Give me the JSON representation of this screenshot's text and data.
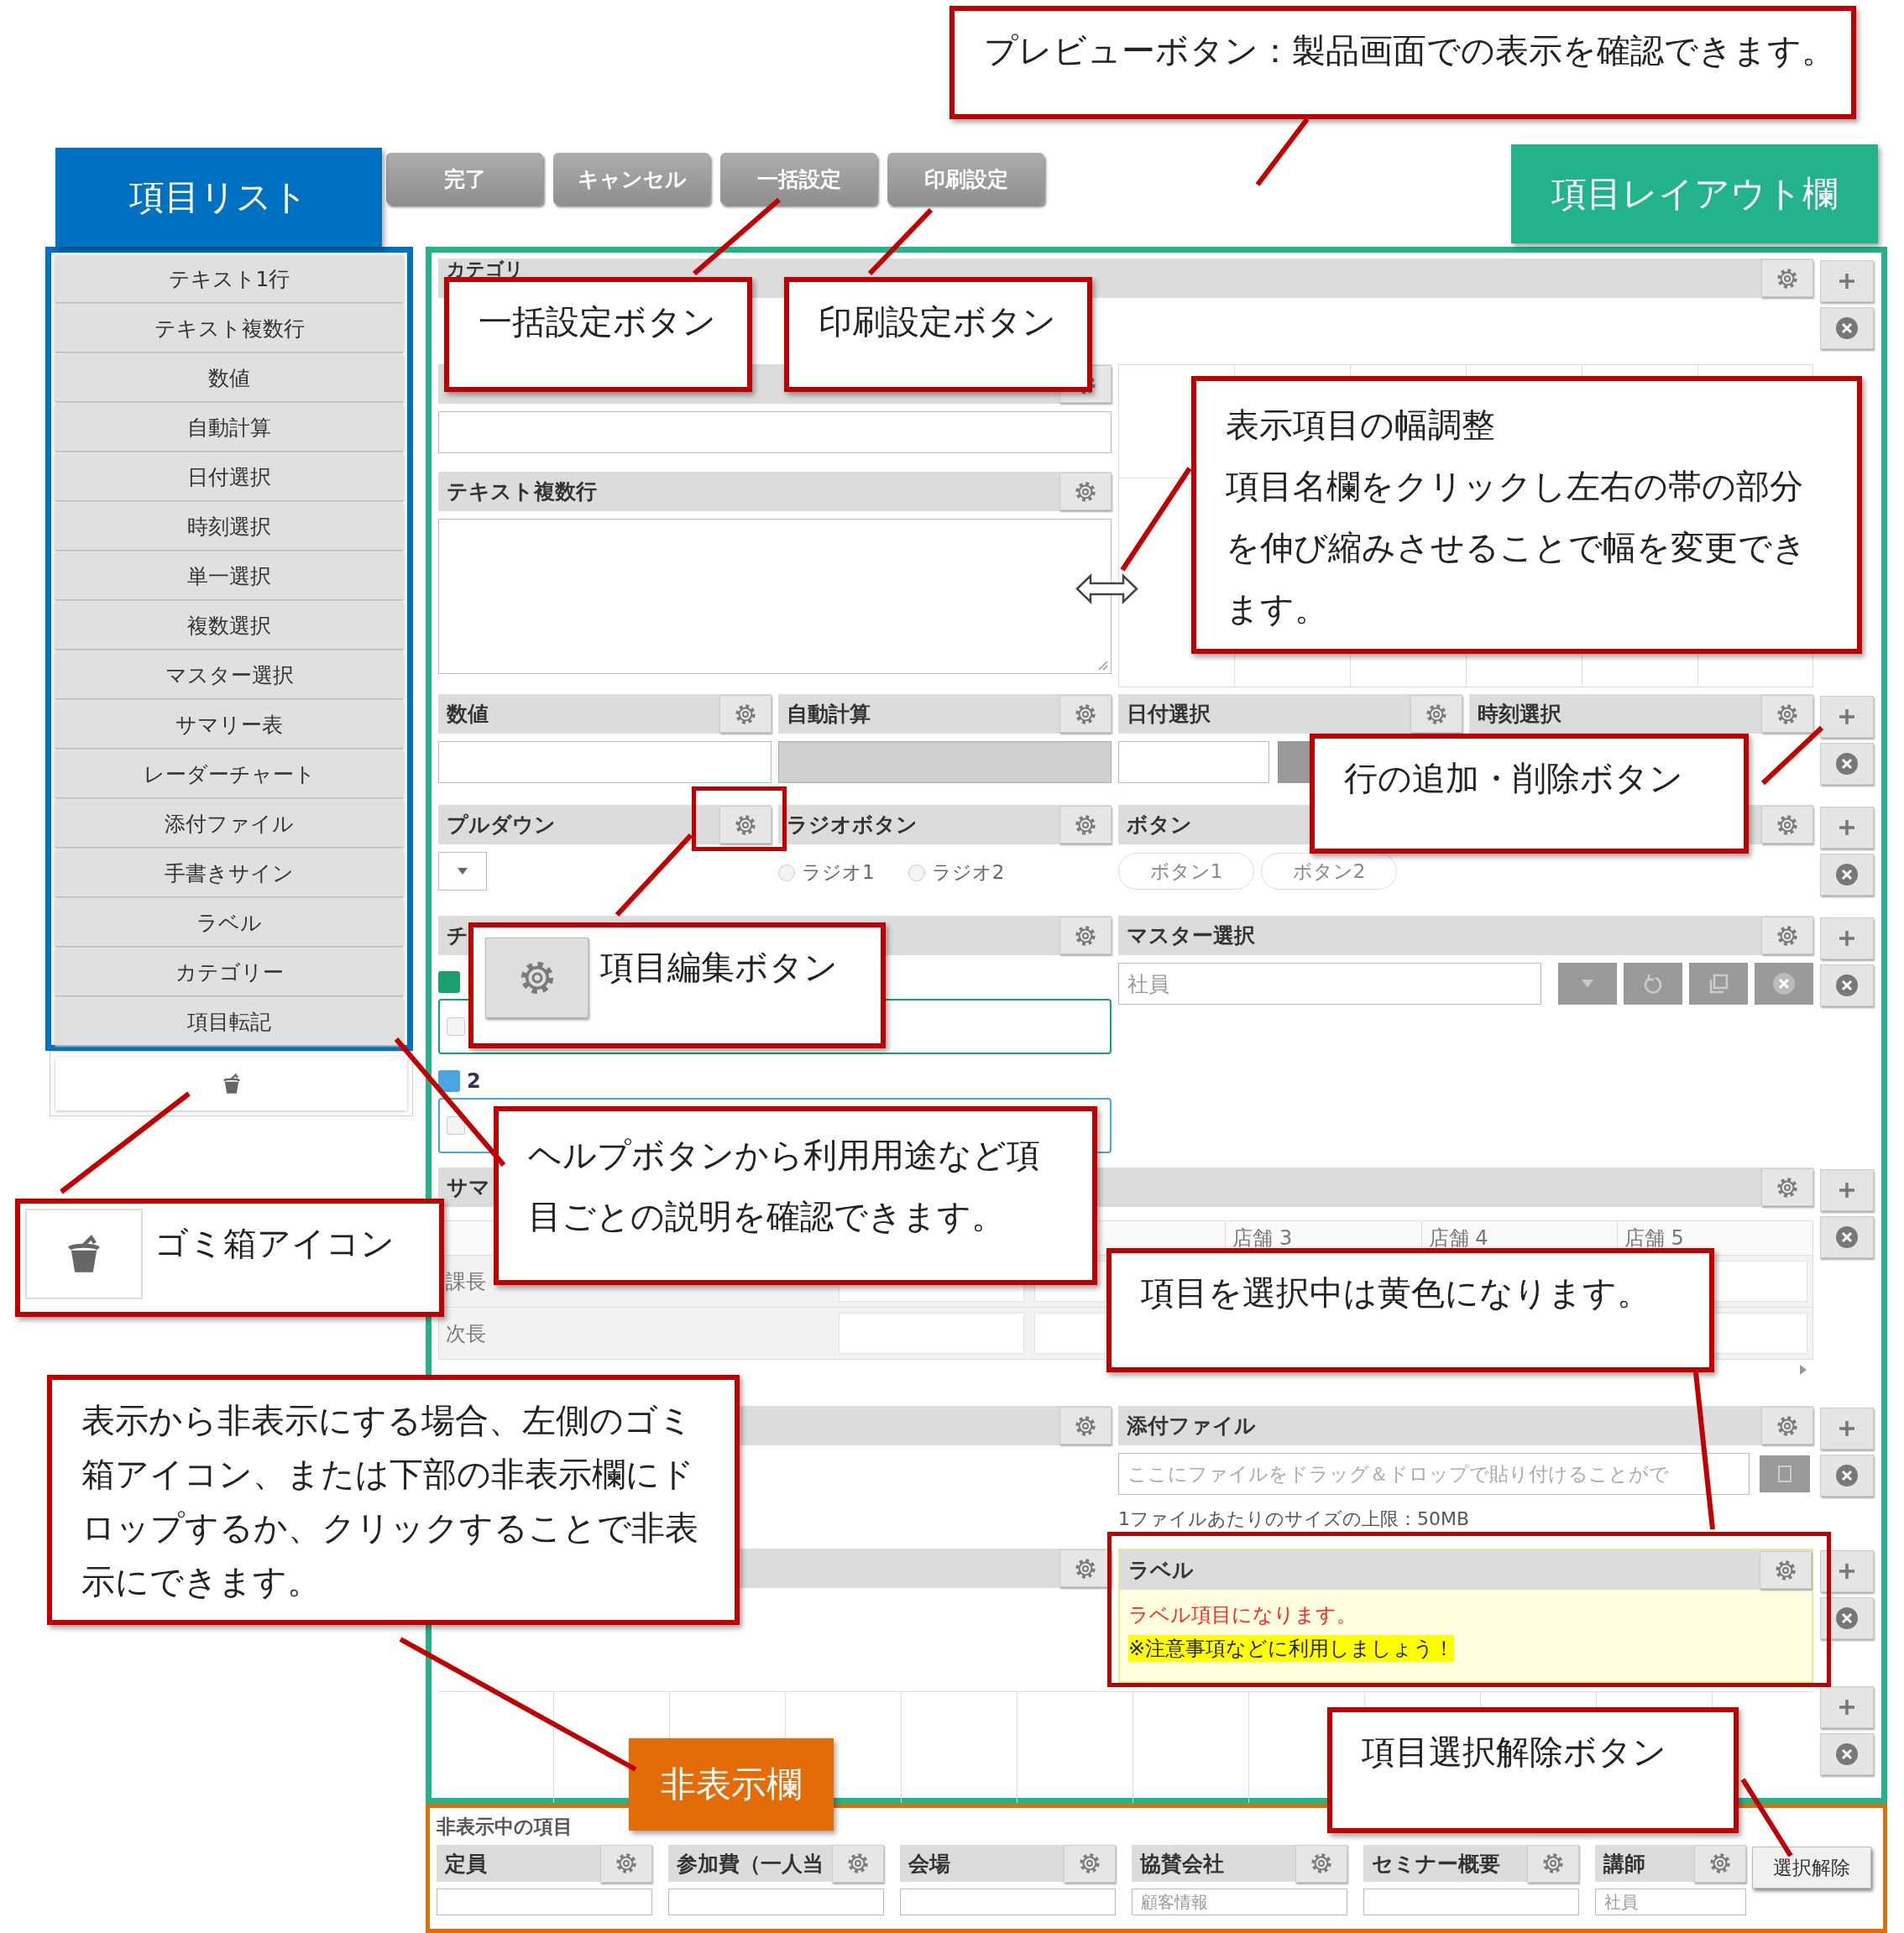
{
  "toolbar": {
    "buttons": [
      "完了",
      "キャンセル",
      "一括設定",
      "印刷設定"
    ]
  },
  "item_list": {
    "items": [
      "テキスト1行",
      "テキスト複数行",
      "数値",
      "自動計算",
      "日付選択",
      "時刻選択",
      "単一選択",
      "複数選択",
      "マスター選択",
      "サマリー表",
      "レーダーチャート",
      "添付ファイル",
      "手書きサイン",
      "ラベル",
      "カテゴリー",
      "項目転記"
    ]
  },
  "layout": {
    "category": {
      "label": "カテゴリ"
    },
    "multiline": {
      "label": "テキスト複数行"
    },
    "number": {
      "label": "数値"
    },
    "auto_calc": {
      "label": "自動計算",
      "disabled": true
    },
    "date": {
      "label": "日付選択"
    },
    "time": {
      "label": "時刻選択"
    },
    "pulldown": {
      "label": "プルダウン"
    },
    "radio": {
      "label": "ラジオボタン",
      "options": [
        {
          "label": "ラジオ1",
          "selected": false
        },
        {
          "label": "ラジオ2",
          "selected": false
        }
      ]
    },
    "buttons": {
      "label": "ボタン",
      "options": [
        "ボタン1",
        "ボタン2"
      ]
    },
    "checklist": {
      "label": "チ",
      "choices": [
        {
          "color": "#1aa06e",
          "checked": false
        },
        {
          "label": "2",
          "color": "#4aa5e0",
          "checked": false
        }
      ]
    },
    "master": {
      "label": "マスター選択",
      "placeholder": "社員"
    },
    "summary": {
      "label": "サマ",
      "columns": [
        "店舗 3",
        "店舗 4",
        "店舗 5"
      ],
      "rows": [
        "課長",
        "次長"
      ]
    },
    "attachment": {
      "label": "添付ファイル",
      "placeholder": "ここにファイルをドラッグ＆ドロップで貼り付けることがで",
      "note": "1ファイルあたりのサイズの上限：50MB"
    },
    "label_item": {
      "label": "ラベル",
      "selected": true,
      "lines": [
        {
          "kind": "alert",
          "text": "ラベル項目になります。"
        },
        {
          "kind": "highlight",
          "text": "※注意事項などに利用しましょう！"
        }
      ]
    }
  },
  "hidden_items": {
    "title": "非表示中の項目",
    "items": [
      {
        "label": "定員"
      },
      {
        "label": "参加費（一人当"
      },
      {
        "label": "会場"
      },
      {
        "label": "協賛会社",
        "placeholder": "顧客情報"
      },
      {
        "label": "セミナー概要"
      },
      {
        "label": "講師",
        "placeholder": "社員"
      }
    ]
  },
  "deselect_button": "選択解除",
  "callouts": [
    {
      "kind": "note",
      "text": "プレビューボタン：製品画面での表示を確認できます。"
    },
    {
      "kind": "label",
      "color": "#0070c0",
      "text": "項目リスト"
    },
    {
      "kind": "label",
      "color": "#22b38b",
      "text": "項目レイアウト欄"
    },
    {
      "kind": "note",
      "text": "一括設定ボタン"
    },
    {
      "kind": "note",
      "text": "印刷設定ボタン"
    },
    {
      "kind": "note_titled",
      "title": "表示項目の幅調整",
      "text": "項目名欄をクリックし左右の帯の部分を伸び縮みさせることで幅を変更できます。"
    },
    {
      "kind": "note",
      "text": "行の追加・削除ボタン"
    },
    {
      "kind": "note_with_gear",
      "text": "項目編集ボタン"
    },
    {
      "kind": "note",
      "text": "ヘルプボタンから利用用途など項目ごとの説明を確認できます。"
    },
    {
      "kind": "note_with_trash",
      "text": "ゴミ箱アイコン"
    },
    {
      "kind": "note",
      "text": "項目を選択中は黄色になります。"
    },
    {
      "kind": "note",
      "text": "表示から非表示にする場合、左側のゴミ箱アイコン、または下部の非表示欄にドロップするか、クリックすることで非表示にできます。"
    },
    {
      "kind": "label",
      "color": "#e36c09",
      "text": "非表示欄"
    },
    {
      "kind": "note",
      "text": "項目選択解除ボタン"
    }
  ]
}
